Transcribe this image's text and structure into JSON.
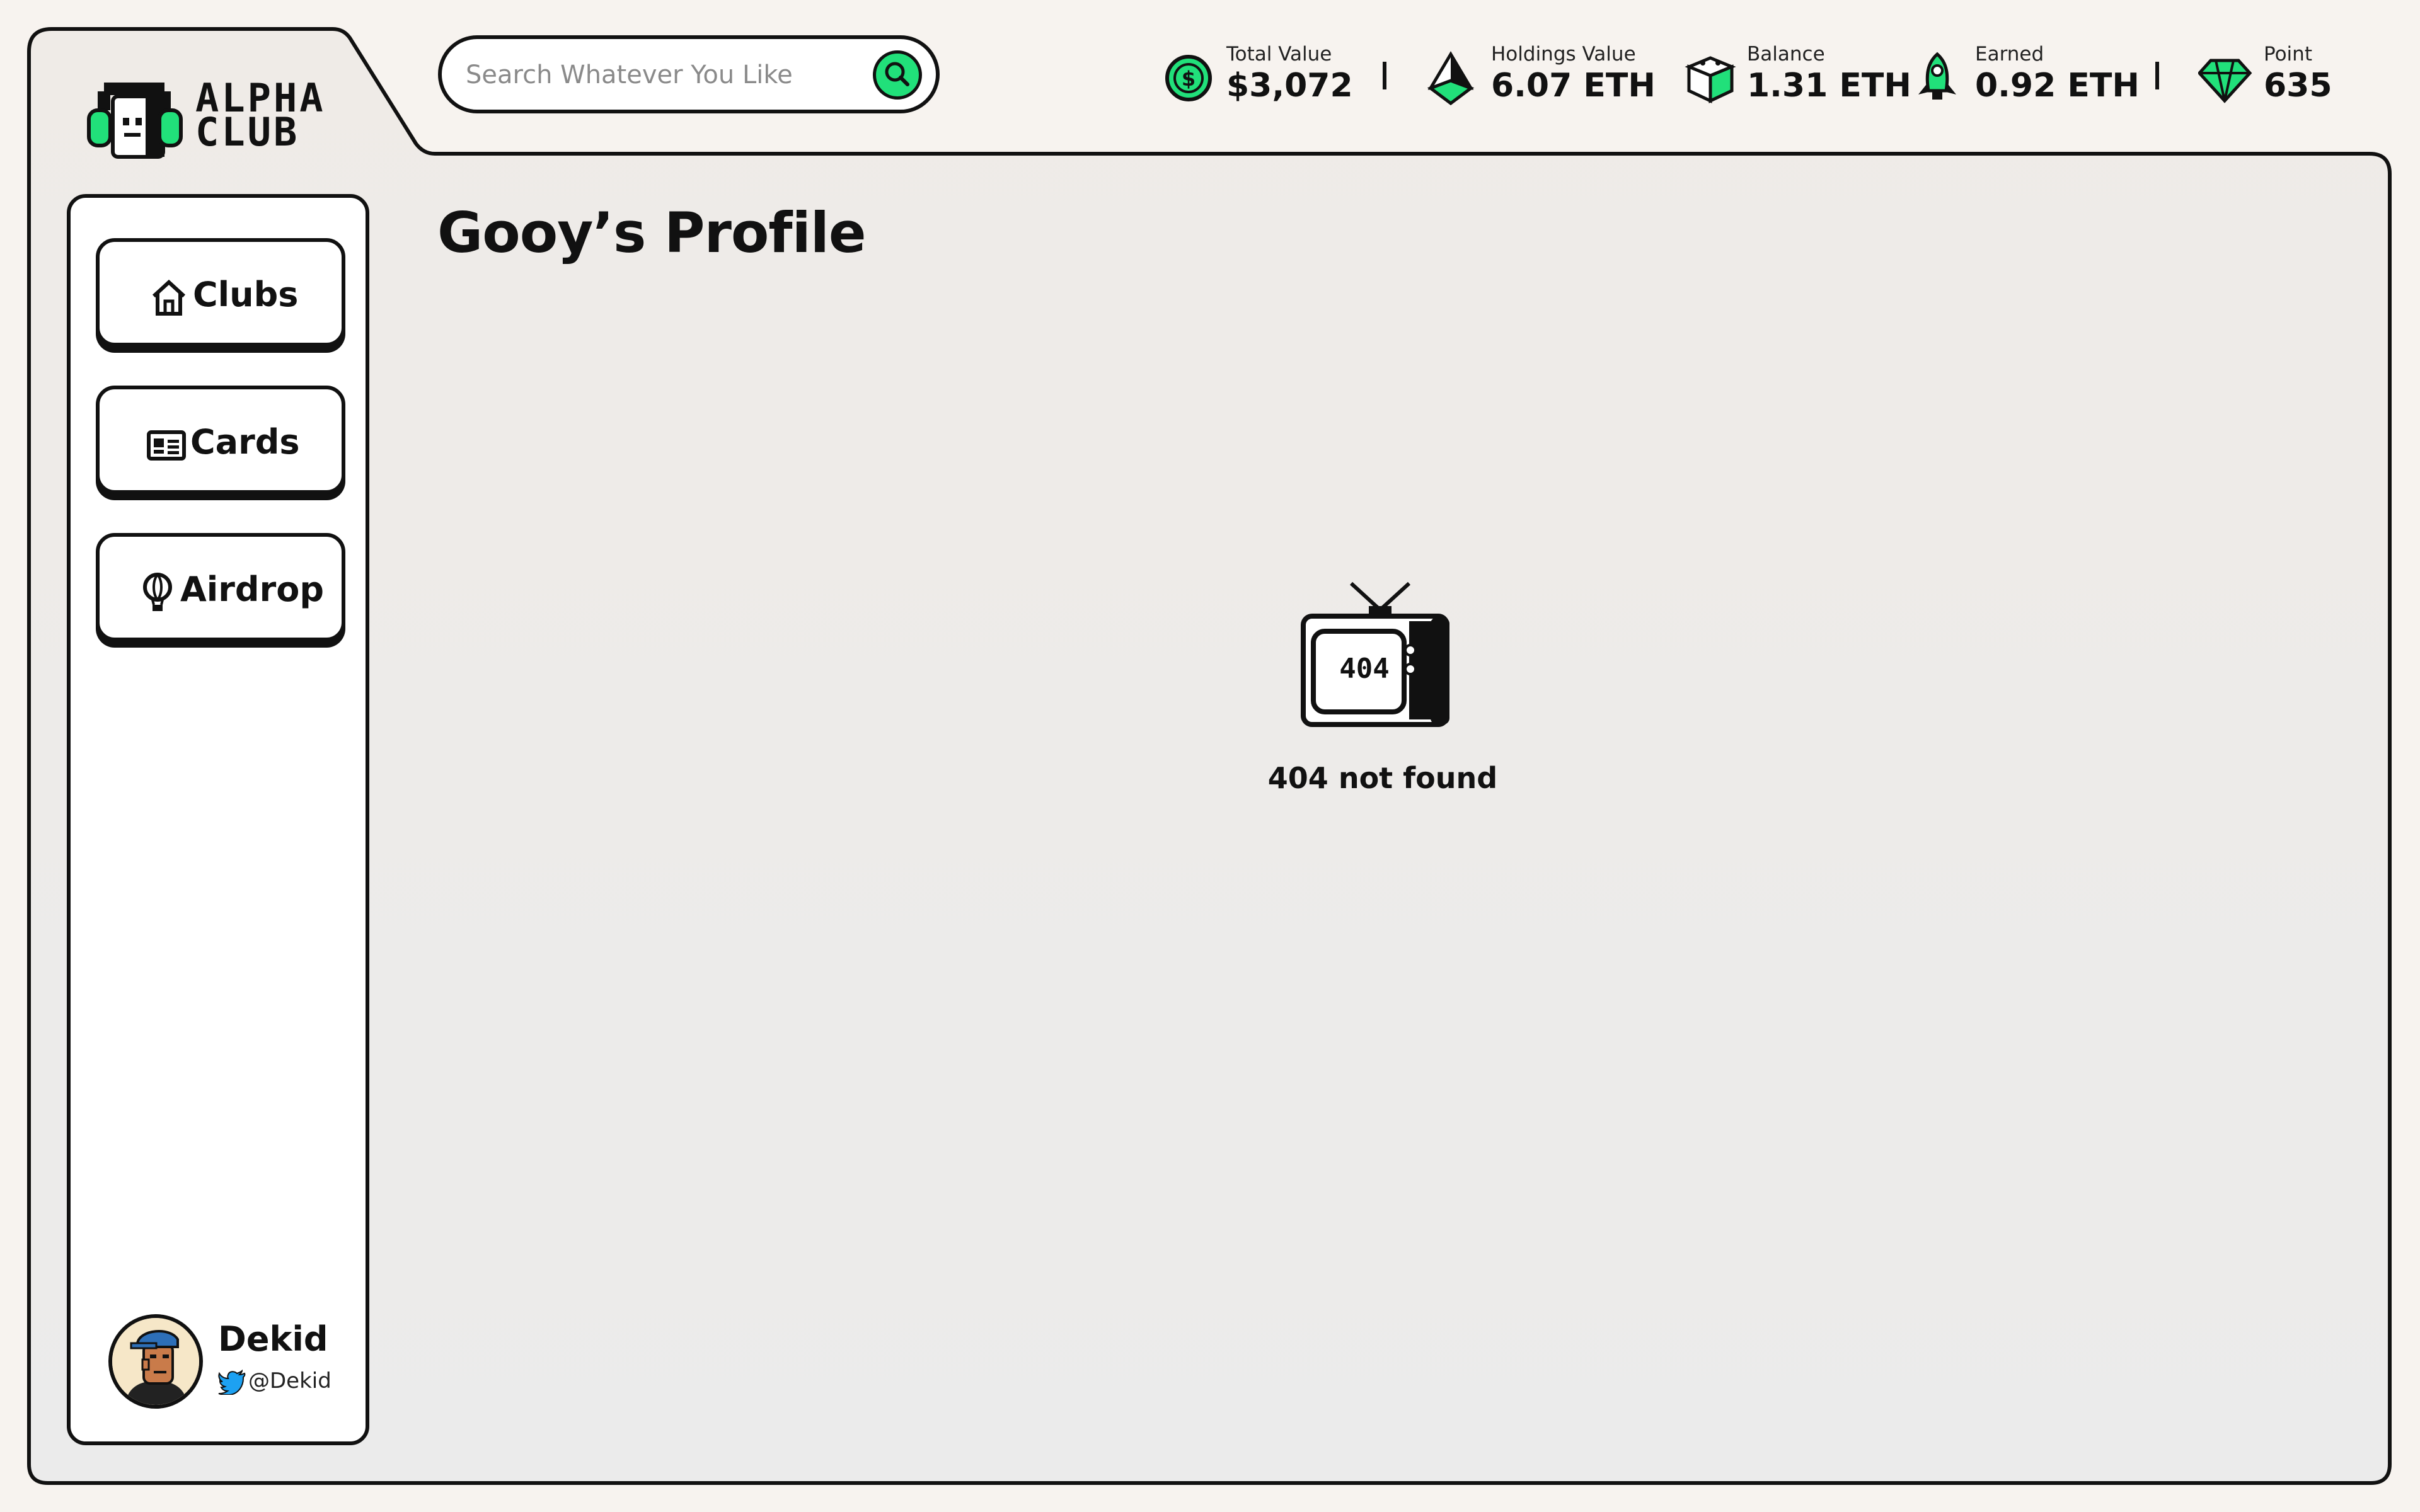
{
  "brand": {
    "logo_line1": "ALPHA",
    "logo_line2": "CLUB"
  },
  "search": {
    "placeholder": "Search Whatever You Like"
  },
  "stats": [
    {
      "label": "Total Value",
      "value": "$3,072",
      "icon": "dollar-coin-icon"
    },
    {
      "label": "Holdings Value",
      "value": "6.07 ETH",
      "icon": "ethereum-icon"
    },
    {
      "label": "Balance",
      "value": "1.31 ETH",
      "icon": "cube-icon"
    },
    {
      "label": "Earned",
      "value": "0.92 ETH",
      "icon": "rocket-icon"
    },
    {
      "label": "Point",
      "value": "635",
      "icon": "diamond-icon"
    }
  ],
  "sidebar": {
    "items": [
      {
        "label": "Clubs",
        "icon": "home-icon"
      },
      {
        "label": "Cards",
        "icon": "card-icon"
      },
      {
        "label": "Airdrop",
        "icon": "balloon-icon"
      }
    ],
    "user": {
      "name": "Dekid",
      "handle": "@Dekid"
    }
  },
  "main": {
    "title": "Gooy’s Profile",
    "error_code": "404",
    "error_message": "404 not found"
  },
  "colors": {
    "accent": "#21e07a",
    "background": "#f7f3ef",
    "outline": "#111111",
    "twitter": "#1da1f2"
  }
}
